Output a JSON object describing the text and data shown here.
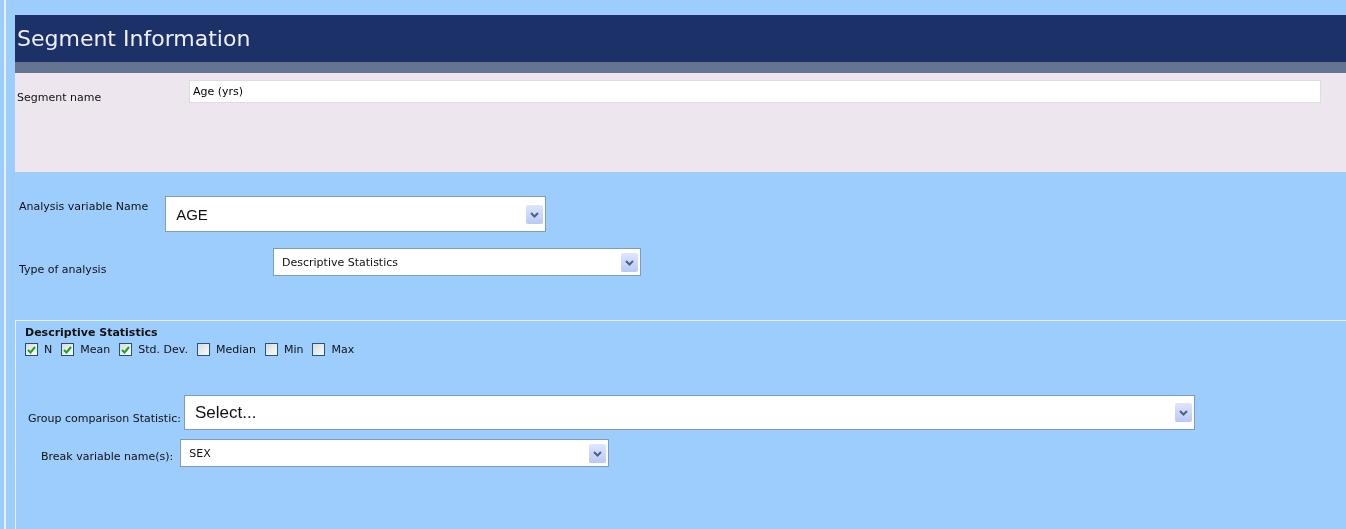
{
  "header": {
    "title": "Segment Information"
  },
  "segment_name": {
    "label": "Segment name",
    "value": "Age (yrs)"
  },
  "analysis_variable": {
    "label": "Analysis variable Name",
    "value": "AGE"
  },
  "analysis_type": {
    "label": "Type of analysis",
    "value": "Descriptive Statistics"
  },
  "descriptive_statistics": {
    "title": "Descriptive Statistics",
    "options": [
      {
        "label": "N",
        "checked": true
      },
      {
        "label": "Mean",
        "checked": true
      },
      {
        "label": "Std. Dev.",
        "checked": true
      },
      {
        "label": "Median",
        "checked": false
      },
      {
        "label": "Min",
        "checked": false
      },
      {
        "label": "Max",
        "checked": false
      }
    ]
  },
  "group_comparison": {
    "label": "Group comparison Statistic:",
    "value": "Select..."
  },
  "break_variable": {
    "label": "Break variable name(s):",
    "value": "SEX"
  }
}
